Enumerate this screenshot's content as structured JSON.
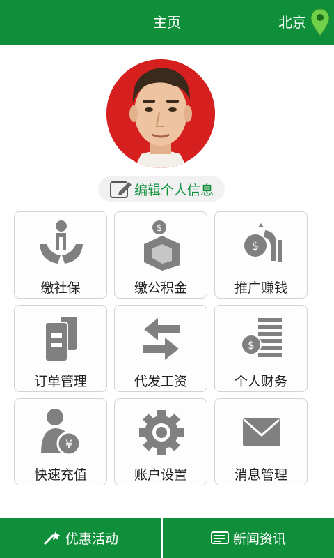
{
  "header": {
    "title": "主页",
    "city": "北京",
    "icons": [
      "location-pin-icon"
    ]
  },
  "profile": {
    "edit_label": "编辑个人信息"
  },
  "grid": {
    "items": [
      {
        "label": "缴社保",
        "icon": "social-security-icon"
      },
      {
        "label": "缴公积金",
        "icon": "housing-fund-icon"
      },
      {
        "label": "推广赚钱",
        "icon": "promote-earn-icon"
      },
      {
        "label": "订单管理",
        "icon": "order-management-icon"
      },
      {
        "label": "代发工资",
        "icon": "payroll-transfer-icon"
      },
      {
        "label": "个人财务",
        "icon": "personal-finance-icon"
      },
      {
        "label": "快速充值",
        "icon": "quick-recharge-icon"
      },
      {
        "label": "账户设置",
        "icon": "account-settings-icon"
      },
      {
        "label": "消息管理",
        "icon": "message-management-icon"
      }
    ]
  },
  "footer": {
    "left_label": "优惠活动",
    "right_label": "新闻资讯"
  },
  "colors": {
    "brand_green": "#0f8f3a",
    "icon_gray": "#808080",
    "avatar_bg": "#d61f1f"
  }
}
